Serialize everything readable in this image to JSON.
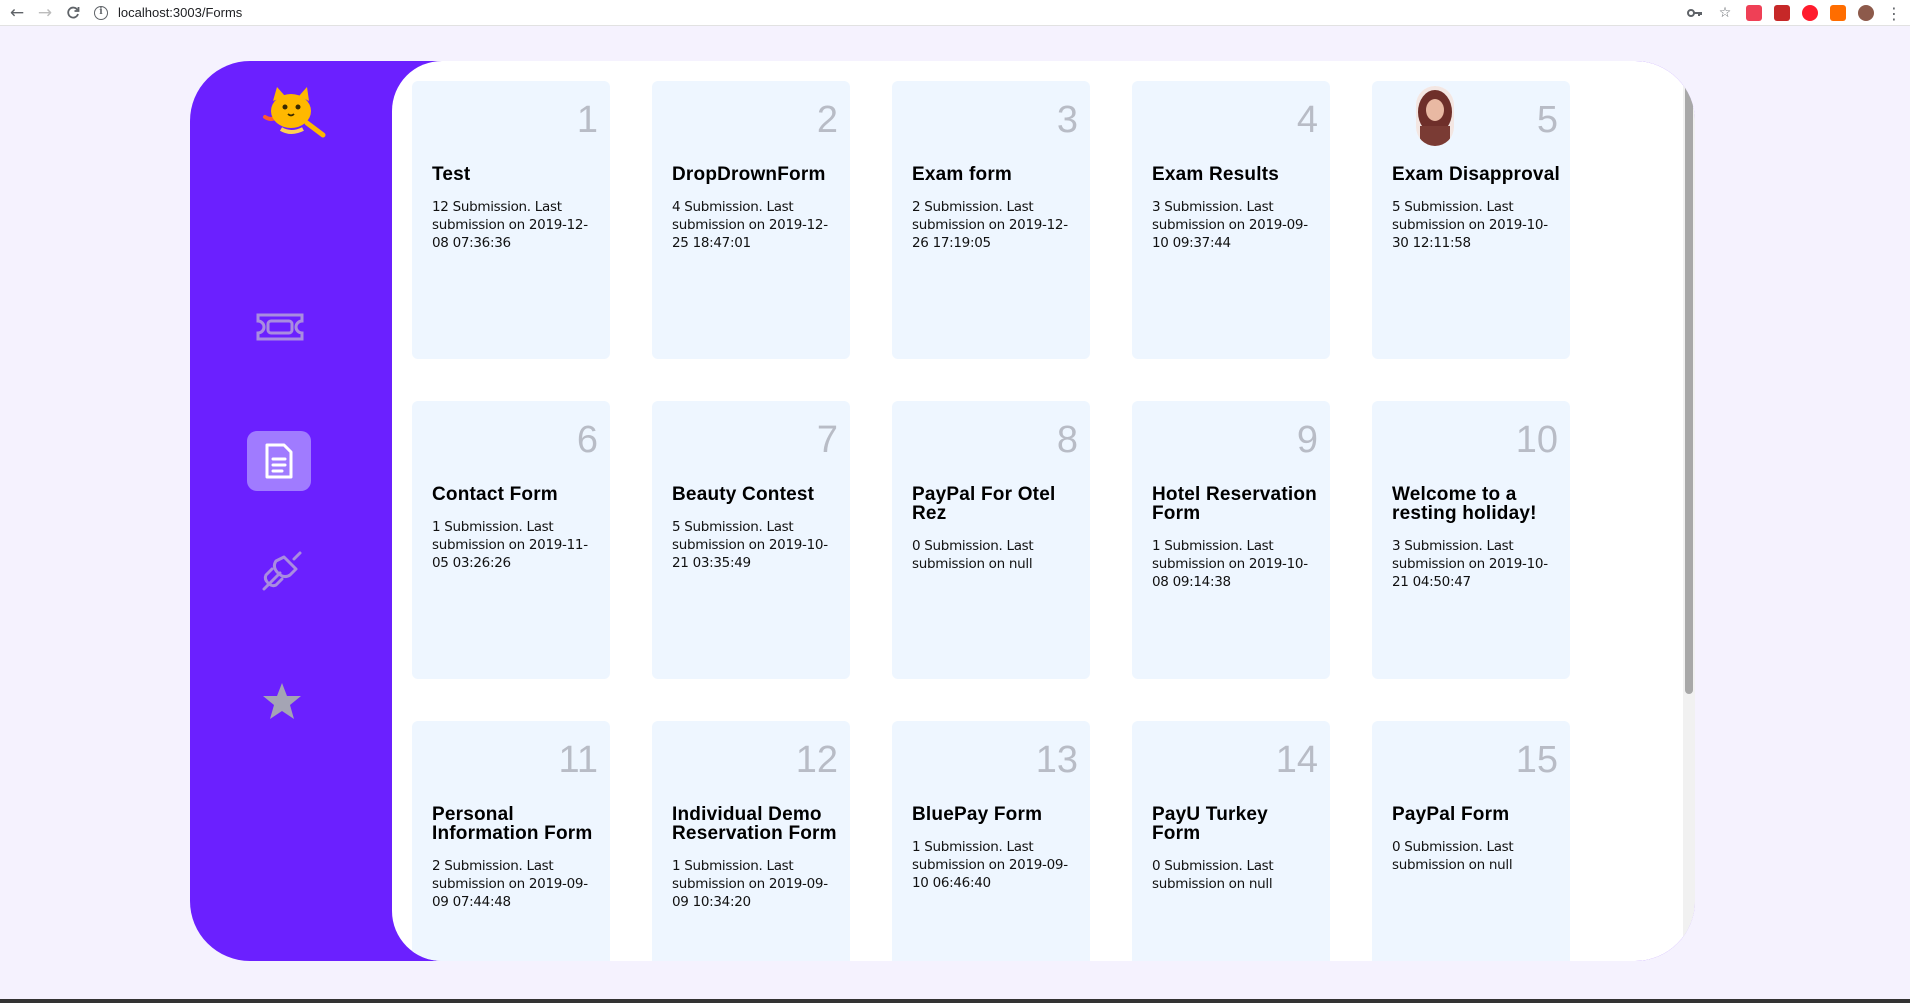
{
  "browser": {
    "url": "localhost:3003/Forms",
    "icons": [
      "back-icon",
      "forward-icon",
      "reload-icon",
      "info-icon",
      "key-icon",
      "star-icon",
      "pocket-icon",
      "ext-red-icon",
      "opera-icon",
      "ext-blue-icon",
      "profile-icon",
      "menu-icon"
    ]
  },
  "sidebar": {
    "items": [
      {
        "name": "ticket",
        "icon": "ticket-icon",
        "active": false
      },
      {
        "name": "forms",
        "icon": "document-icon",
        "active": true
      },
      {
        "name": "integrations",
        "icon": "plug-icon",
        "active": false
      },
      {
        "name": "favorites",
        "icon": "star-icon",
        "active": false
      }
    ]
  },
  "colors": {
    "sidebar": "#6b20ff",
    "active_item": "#a07bff",
    "card_bg": "#eef6ff",
    "page_bg": "#f5f2fe"
  },
  "forms": [
    {
      "num": "1",
      "title": "Test",
      "sub": "12 Submission. Last submission on 2019-12-08 07:36:36"
    },
    {
      "num": "2",
      "title": "DropDrownForm",
      "sub": "4 Submission. Last submission on 2019-12-25 18:47:01"
    },
    {
      "num": "3",
      "title": "Exam form",
      "sub": "2 Submission. Last submission on 2019-12-26 17:19:05"
    },
    {
      "num": "4",
      "title": "Exam Results",
      "sub": "3 Submission. Last submission on 2019-09-10 09:37:44"
    },
    {
      "num": "5",
      "title": "Exam Disapproval",
      "sub": "5 Submission. Last submission on 2019-10-30 12:11:58"
    },
    {
      "num": "6",
      "title": "Contact Form",
      "sub": "1 Submission. Last submission on 2019-11-05 03:26:26"
    },
    {
      "num": "7",
      "title": "Beauty Contest",
      "sub": "5 Submission. Last submission on 2019-10-21 03:35:49"
    },
    {
      "num": "8",
      "title": "PayPal For Otel Rez",
      "sub": "0 Submission. Last submission on null"
    },
    {
      "num": "9",
      "title": "Hotel Reservation Form",
      "sub": "1 Submission. Last submission on 2019-10-08 09:14:38"
    },
    {
      "num": "10",
      "title": "Welcome to a resting holiday!",
      "sub": "3 Submission. Last submission on 2019-10-21 04:50:47"
    },
    {
      "num": "11",
      "title": "Personal Information Form",
      "sub": "2 Submission. Last submission on 2019-09-09 07:44:48"
    },
    {
      "num": "12",
      "title": "Individual Demo Reservation Form",
      "sub": "1 Submission. Last submission on 2019-09-09 10:34:20"
    },
    {
      "num": "13",
      "title": "BluePay Form",
      "sub": "1 Submission. Last submission on 2019-09-10 06:46:40"
    },
    {
      "num": "14",
      "title": "PayU Turkey Form",
      "sub": "0 Submission. Last submission on null"
    },
    {
      "num": "15",
      "title": "PayPal Form",
      "sub": "0 Submission. Last submission on null"
    }
  ]
}
